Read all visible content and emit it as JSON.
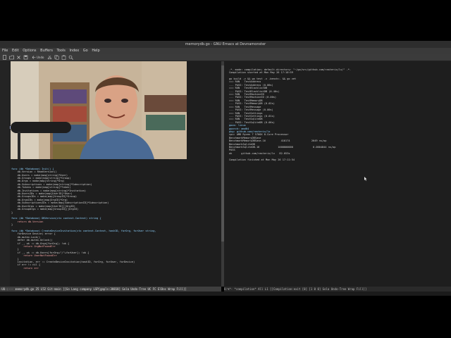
{
  "window": {
    "title": "memorydb.go - GNU Emacs at Devnamonster"
  },
  "menubar": {
    "items": [
      "File",
      "Edit",
      "Options",
      "Buffers",
      "Tools",
      "Index",
      "Go",
      "Help"
    ]
  },
  "toolbar": {
    "undo_label": "Undo",
    "icons": [
      "new-file-icon",
      "open-folder-icon",
      "close-icon",
      "save-icon",
      "undo-icon",
      "cut-icon",
      "copy-icon",
      "paste-icon",
      "search-icon"
    ]
  },
  "editor_left": {
    "lines": [
      "func (db *Database) Init() {",
      "    db.Version = ReadVersion()",
      "    db.Users = make(map[string]*User)",
      "    db.Groups = make(map[string]*Group)",
      "    db.Orgs = make(map[string]*Org)",
      "    db.Subscriptions = make(map[string]*Subscription)",
      "    db.Tokens = make(map[string]*Token)",
      "    db.Invitations = make(map[string]*Invitation)",
      "    db.UsersIDs = make(map[UserID]*User)",
      "    db.GroupsIDs = make(map[GroupID]*Group)",
      "    db.OrgsIDs = make(map[OrgID]*Org)",
      "    db.SubscriptionsIDs = make(map[SubscriptionID]*Subscription)",
      "    db.UserOrgs = make(map[UserID][]OrgID)",
      "    db.GroupOrgs = make(map[GroupID][]OrgID)",
      "}",
      "",
      "func (db *Database) DBVersion(ctx context.Context) string {",
      "    return db.Version",
      "}",
      "",
      "func (db *Database) CreateDeviceInvitation(ctx context.Context, hashID, forOrg, forUser string,",
      "    forDevice Device) error {",
      "    db.mutex.Lock()",
      "    defer db.mutex.Unlock()",
      "    if _, ok := db.Orgs[forOrg]; !ok {",
      "        return OrgNotFoundErr",
      "    }",
      "    if _, ok := db.Users[forOrg+\"/\"+forUser]; !ok {",
      "        return UserNotFoundErr",
      "    }",
      "    invitation, err := CreateDeviceInvitation(hashID, forOrg, forUser, forDevice)",
      "    if err != nil {",
      "        return err"
    ]
  },
  "editor_right": {
    "lines": [
      "-*- mode: compilation; default-directory: \"~/go/src/github.com/rasterix/lx/\" -*-",
      "Compilation started at Mon May 26 17:10:59",
      "",
      "go build -v && go test -v -bench=. && go vet",
      "=== RUN   TestAddress",
      "--- PASS: TestAddress (0.00s)",
      "=== RUN   TestBlacklistDB",
      "--- PASS: TestBlacklistDB (0.40s)",
      "=== RUN   TestMachineID",
      "--- PASS: TestMachineID (0.00s)",
      "=== RUN   TestMemoryDB",
      "--- PASS: TestMemoryDB (0.02s)",
      "=== RUN   TestMessage",
      "--- PASS: TestMessage (0.00s)",
      "=== RUN   TestSettings",
      "--- PASS: TestSettings (0.01s)",
      "=== RUN   TestSqliteDB",
      "--- PASS: TestSqliteDB (0.06s)",
      "goos: linux",
      "goarch: amd64",
      "pkg: github.com/rasterix/lx",
      "cpu: AMD Ryzen 7 5700X 8-Core Processor",
      "BenchmarkMemoryDBSave",
      "BenchmarkMemoryDBSave-16          410174              2649 ns/op",
      "BenchmarkSqliteDB",
      "BenchmarkSqliteDB-16            1000000000             0.0004844 ns/op",
      "PASS",
      "ok      github.com/rasterix/lx   82.053s",
      "",
      "Compilation finished at Mon May 26 17:11:54"
    ]
  },
  "modeline_left": {
    "text": "-UU-:---  memorydb.go   25  L52   Git-main  [[Go Lang company LSP[gopls:38818] Gola Undo-Tree UC FC ElDoc Wrap Fill]]  "
  },
  "modeline_right": {
    "text": "U:%*-  *compilation*    All   L1    [[Compilation:exit [0] [1 0 0] Gola Undo-Tree Wrap Fill]]"
  },
  "colors": {
    "background": "#1e1e1e",
    "modeline_active": "#3e3e3e",
    "keyword": "#f0a0a0",
    "function": "#8fd3ff",
    "string": "#a5e68a"
  }
}
